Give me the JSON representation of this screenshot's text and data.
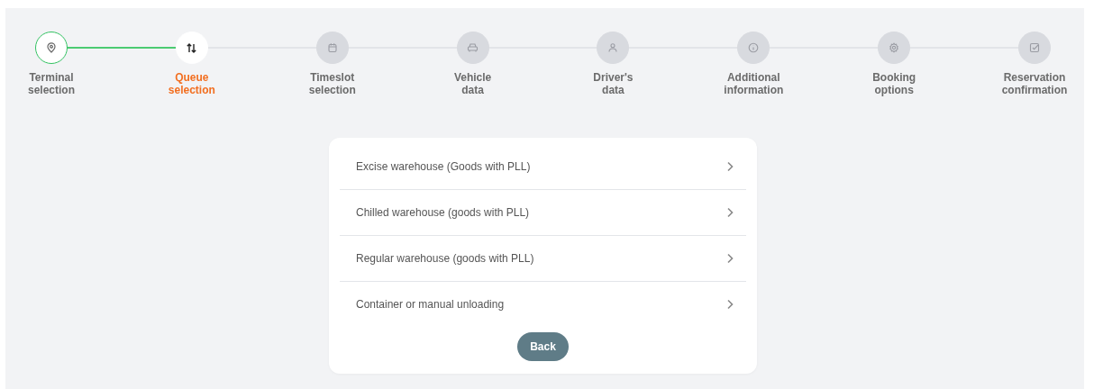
{
  "steps": [
    {
      "label": "Terminal selection",
      "completed": true,
      "selected": false
    },
    {
      "label": "Queue selection",
      "completed": false,
      "selected": true
    },
    {
      "label": "Timeslot selection",
      "completed": false,
      "selected": false
    },
    {
      "label": "Vehicle data",
      "completed": false,
      "selected": false
    },
    {
      "label": "Driver's data",
      "completed": false,
      "selected": false
    },
    {
      "label": "Additional information",
      "completed": false,
      "selected": false
    },
    {
      "label": "Booking options",
      "completed": false,
      "selected": false
    },
    {
      "label": "Reservation confirmation",
      "completed": false,
      "selected": false
    }
  ],
  "queues": [
    {
      "label": "Excise warehouse (Goods with PLL)"
    },
    {
      "label": "Chilled warehouse (goods with PLL)"
    },
    {
      "label": "Regular warehouse (goods with PLL)"
    },
    {
      "label": "Container or manual unloading"
    }
  ],
  "back_button": "Back"
}
